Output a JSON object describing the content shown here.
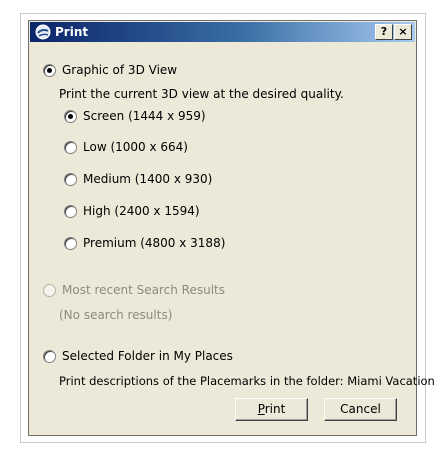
{
  "window": {
    "title": "Print",
    "help_label": "?",
    "close_label": "×"
  },
  "graphic_option": {
    "label": "Graphic of 3D View",
    "selected": true,
    "description": "Print the current 3D view at the desired quality.",
    "qualities": [
      {
        "label": "Screen (1444 x 959)",
        "selected": true
      },
      {
        "label": "Low (1000 x 664)",
        "selected": false
      },
      {
        "label": "Medium (1400 x 930)",
        "selected": false
      },
      {
        "label": "High (2400 x 1594)",
        "selected": false
      },
      {
        "label": "Premium (4800 x 3188)",
        "selected": false
      }
    ]
  },
  "search_option": {
    "label": "Most recent Search Results",
    "enabled": false,
    "description": "(No search results)"
  },
  "folder_option": {
    "label": "Selected Folder in My Places",
    "description": "Print descriptions of the Placemarks in the folder: Miami Vacation"
  },
  "buttons": {
    "print_label_prefix": "P",
    "print_label_rest": "rint",
    "cancel_label": "Cancel"
  }
}
